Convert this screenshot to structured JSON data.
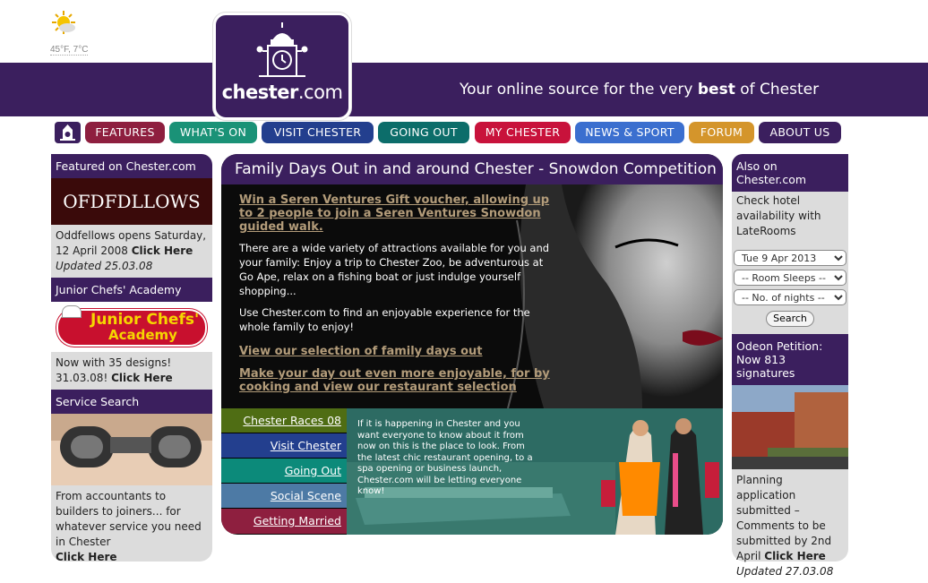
{
  "weather": {
    "temp": "45°F, 7°C",
    "icon": "partly-cloudy-icon"
  },
  "logo": {
    "name": "chester",
    "suffix": ".com"
  },
  "tagline": {
    "pre": "Your online source for the very ",
    "bold": "best",
    "post": " of Chester"
  },
  "nav": {
    "home_icon": "town-hall-icon",
    "tabs": [
      {
        "label": "FEATURES",
        "color": "#8e1f3f"
      },
      {
        "label": "WHAT'S ON",
        "color": "#1a9277"
      },
      {
        "label": "VISIT CHESTER",
        "color": "#233f8e"
      },
      {
        "label": "GOING OUT",
        "color": "#0c6d6a"
      },
      {
        "label": "MY CHESTER",
        "color": "#c8123b"
      },
      {
        "label": "NEWS & SPORT",
        "color": "#3b6fcf"
      },
      {
        "label": "FORUM",
        "color": "#d4952b"
      },
      {
        "label": "ABOUT US",
        "color": "#3b1f5e"
      }
    ]
  },
  "left": {
    "featured": {
      "header": "Featured on Chester.com",
      "banner": "OFDFDLLOWS",
      "text": "Oddfellows opens Saturday, 12 April 2008",
      "link": "Click Here",
      "updated": "Updated 25.03.08"
    },
    "junior": {
      "header": "Junior Chefs' Academy",
      "logo_line1": "Junior Chefs'",
      "logo_line2": "Academy",
      "text": "Now with 35 designs! 31.03.08!",
      "link": "Click Here"
    },
    "service": {
      "header": "Service Search",
      "text": "From accountants to builders to joiners... for whatever service you need in Chester",
      "link": "Click Here"
    }
  },
  "main": {
    "title": "Family Days Out in and around Chester - Snowdon Competition",
    "link1": "Win a Seren Ventures Gift voucher, allowing up to 2 people to join a Seren Ventures Snowdon guided walk.",
    "para1": "There are a wide variety of attractions available for you and your family: Enjoy a trip to Chester Zoo, be adventurous at Go Ape, relax on a fishing boat or just indulge yourself shopping...",
    "para2": "Use Chester.com to find an enjoyable experience for the whole family to enjoy!",
    "link2": "View our selection of family days out",
    "link3": "Make your day out even more enjoyable, for by cooking and view our restaurant selection",
    "bottom_links": [
      {
        "label": "Chester Races 08",
        "color": "#4f6d14"
      },
      {
        "label": "Visit Chester",
        "color": "#233f8e"
      },
      {
        "label": "Going Out",
        "color": "#0c8a7a"
      },
      {
        "label": "Social Scene",
        "color": "#4d7aa5"
      },
      {
        "label": "Getting Married",
        "color": "#8e1f3f"
      }
    ],
    "promo": "If it is happening in Chester and you want everyone to know about it from now on this is the place to look. From the latest chic restaurant opening, to a spa opening or business launch, Chester.com will be letting everyone know!"
  },
  "right": {
    "also": {
      "header": "Also on Chester.com",
      "text": "Check hotel availability with LateRooms",
      "date": "Tue 9 Apr 2013",
      "room": "-- Room Sleeps --",
      "nights": "-- No. of nights --",
      "search": "Search"
    },
    "odeon": {
      "header": "Odeon Petition: Now 813 signatures",
      "text": "Planning application submitted – Comments to be submitted by 2nd April",
      "link": "Click Here",
      "updated": "Updated 27.03.08"
    }
  }
}
